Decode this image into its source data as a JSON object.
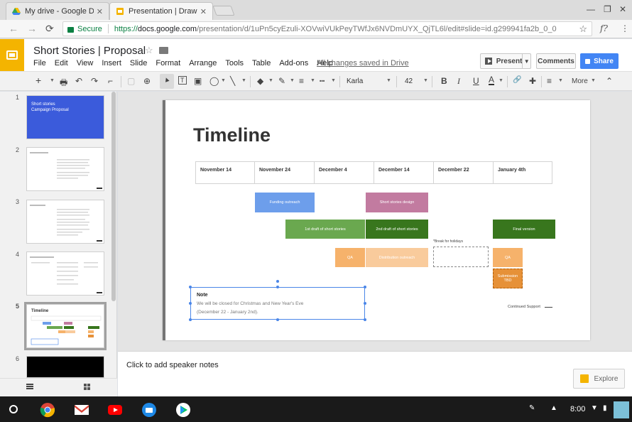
{
  "browser": {
    "tabs": [
      {
        "label": "My drive - Google Drive",
        "close": "✕"
      },
      {
        "label": "Presentation | Drawings",
        "close": "✕"
      }
    ],
    "window_controls": [
      "—",
      "❐",
      "✕"
    ],
    "nav": {
      "back": "←",
      "forward": "→",
      "reload": "⟳"
    },
    "address": {
      "secure_label": "Secure",
      "scheme": "https://",
      "host": "docs.google.com",
      "path": "/presentation/d/1uPn5cyEzuli-XOVwiVUkPeyTWfJx6NVDmUYX_QjTL6l/edit#slide=id.g299941fa2b_0_0"
    },
    "right_icons": {
      "bookmark": "☆",
      "ext": "f?",
      "menu": "⋮"
    }
  },
  "doc": {
    "title": "Short Stories | Proposal",
    "star": "☆",
    "menus": [
      "File",
      "Edit",
      "View",
      "Insert",
      "Slide",
      "Format",
      "Arrange",
      "Tools",
      "Table",
      "Add-ons",
      "Help"
    ],
    "saved_status": "All changes saved in Drive",
    "present_label": "Present",
    "comments_label": "Comments",
    "share_label": "Share"
  },
  "toolbar": {
    "font": "Karla",
    "size": "42",
    "more_label": "More",
    "glyphs": {
      "add": "+",
      "print": "🖶",
      "undo": "↶",
      "redo": "↷",
      "paint": "⌐",
      "select": "▲",
      "textbox": "T",
      "image": "▣",
      "shape": "◯",
      "line": "╲",
      "fill": "◆",
      "pen": "✎",
      "weight": "≡",
      "dash": "┅",
      "bold": "B",
      "italic": "I",
      "underline": "U",
      "color": "A",
      "link": "🔗",
      "comment": "✚",
      "align": "≡",
      "collapse": "⌃",
      "zoom": "⊕"
    }
  },
  "filmstrip": {
    "numbers": [
      "1",
      "2",
      "3",
      "4",
      "5",
      "6"
    ],
    "slide1_lines": [
      "Short stories",
      "Campaign Proposal"
    ],
    "slide5_title": "Timeline"
  },
  "slide": {
    "title": "Timeline",
    "dates": [
      "November 14",
      "November 24",
      "December 4",
      "December 14",
      "December 22",
      "January 4th"
    ],
    "bars": {
      "funding": "Funding outreach",
      "design": "Short stories design",
      "draft1": "1st draft of short stories",
      "draft2": "2nd draft of short stories",
      "final": "Final version",
      "qa1": "QA",
      "dist": "Distribution outreach",
      "qa2": "QA",
      "submission": "Submission TBD"
    },
    "break_label": "*Break for holidays",
    "note": {
      "title": "Note",
      "line1": "We will be closed for Christmas and New Year's Eve",
      "line2": "(December 22 - January 2nd)."
    },
    "continued": "Continued Support"
  },
  "notes": {
    "placeholder": "Click to add speaker notes"
  },
  "explore_label": "Explore",
  "shelf": {
    "time": "8:00"
  },
  "colors": {
    "slides_yellow": "#f4b400",
    "share_blue": "#4285f4",
    "bar_blue": "#6d9eeb",
    "bar_pink": "#c27ba0",
    "bar_green": "#6aa84f",
    "bar_darkgreen": "#38761d",
    "bar_orange": "#f6b26b",
    "bar_peach": "#f9cb9c",
    "bar_dark_orange": "#e69138"
  }
}
